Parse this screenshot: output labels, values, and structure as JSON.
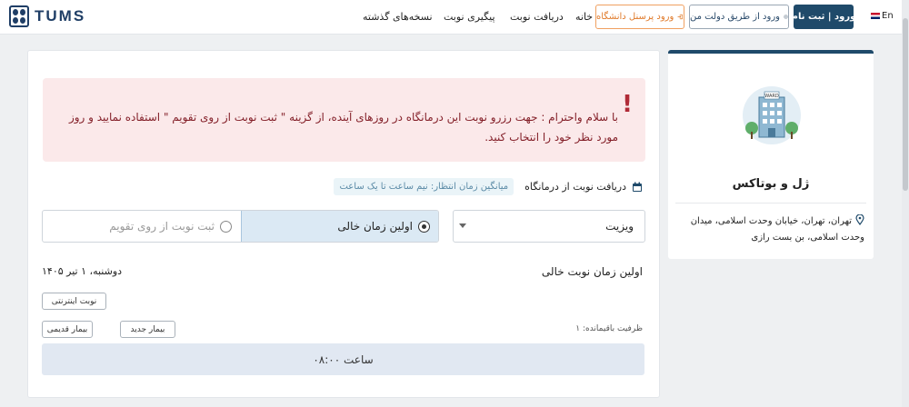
{
  "header": {
    "logo_text": "TUMS",
    "nav": {
      "previous_prescriptions": "نسخه‌های گذشته",
      "track": "پیگیری نوبت",
      "get_appointment": "دریافت نوبت",
      "home": "خانه"
    },
    "staff_login": "ورود پرسنل دانشگاه",
    "gov_login": "ورود از طریق دولت من",
    "login_register": "ورود | ثبت نام",
    "language": "En"
  },
  "clinic": {
    "ward_label": "WARD",
    "name": "ژل و بوتاکس",
    "address": "تهران، تهران، خیابان وحدت اسلامی، میدان وحدت اسلامی، بن بست رازی"
  },
  "main": {
    "alert_icon": "!",
    "alert_text": "با سلام واحترام : جهت رزرو نوبت این درمانگاه در روزهای آینده، از گزینه \" ثبت نوبت از روی تقویم \" استفاده نمایید و روز مورد نظر خود را انتخاب کنید.",
    "section_title": "دریافت نوبت از درمانگاه",
    "wait_badge": "میانگین زمان انتظار: نیم ساعت تا یک ساعت",
    "visit_type": "ویزیت",
    "radio_first": "اولین زمان خالی",
    "radio_calendar": "ثبت نوبت از روی تقویم",
    "first_slot_title": "اولین زمان نوبت خالی",
    "date": "دوشنبه، ۱ تیر ۱۴۰۵",
    "tag_online": "نوبت اینترنتی",
    "tag_new": "بیمار جدید",
    "tag_old": "بیمار قدیمی",
    "capacity": "ظرفیت باقیمانده: ۱",
    "slot_time": "ساعت ۰۸:۰۰"
  }
}
